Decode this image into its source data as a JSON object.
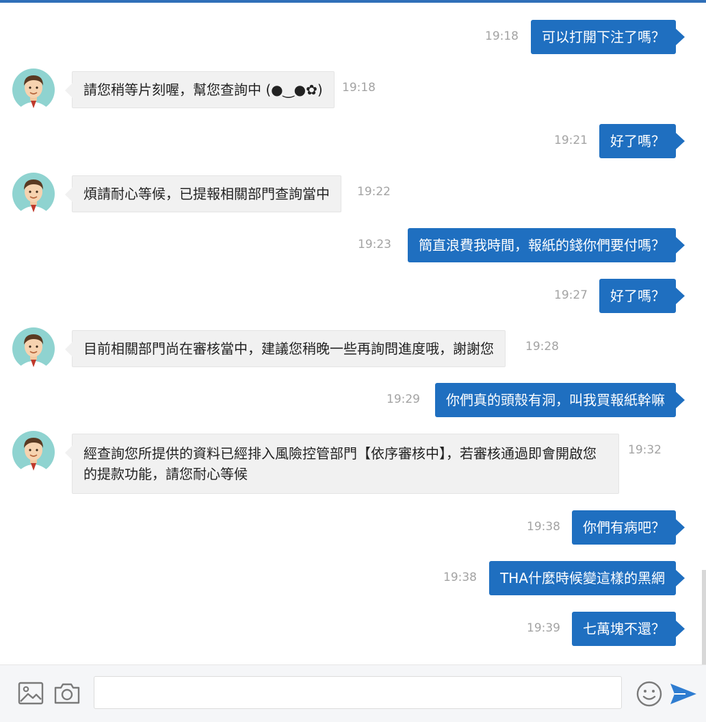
{
  "colors": {
    "outgoing_bubble": "#1f6fc0",
    "incoming_bubble": "#f1f1f1",
    "timestamp": "#a3a3a3",
    "accent": "#2f6fb8"
  },
  "messages": [
    {
      "text": "可以打開下注了嗎？",
      "time": "19:18"
    },
    {
      "text": "請您稍等片刻喔，幫您查詢中 (●‿●✿)",
      "time": "19:18"
    },
    {
      "text": "好了嗎？",
      "time": "19:21"
    },
    {
      "text": "煩請耐心等候，已提報相關部門查詢當中",
      "time": "19:22"
    },
    {
      "text": "簡直浪費我時間，報紙的錢你們要付嗎？",
      "time": "19:23"
    },
    {
      "text": "好了嗎？",
      "time": "19:27"
    },
    {
      "text": "目前相關部門尚在審核當中，建議您稍晚一些再詢問進度哦，謝謝您",
      "time": "19:28"
    },
    {
      "text": "你們真的頭殼有洞，叫我買報紙幹嘛",
      "time": "19:29"
    },
    {
      "text": "經查詢您所提供的資料已經排入風險控管部門【依序審核中】，若審核通過即會開啟您的提款功能，請您耐心等候",
      "time": "19:32"
    },
    {
      "text": "你們有病吧？",
      "time": "19:38"
    },
    {
      "text": "THA什麼時候變這樣的黑網",
      "time": "19:38"
    },
    {
      "text": "七萬塊不還？",
      "time": "19:39"
    }
  ],
  "input": {
    "value": "",
    "icons": [
      "image-icon",
      "camera-icon",
      "emoji-icon",
      "send-icon"
    ]
  }
}
